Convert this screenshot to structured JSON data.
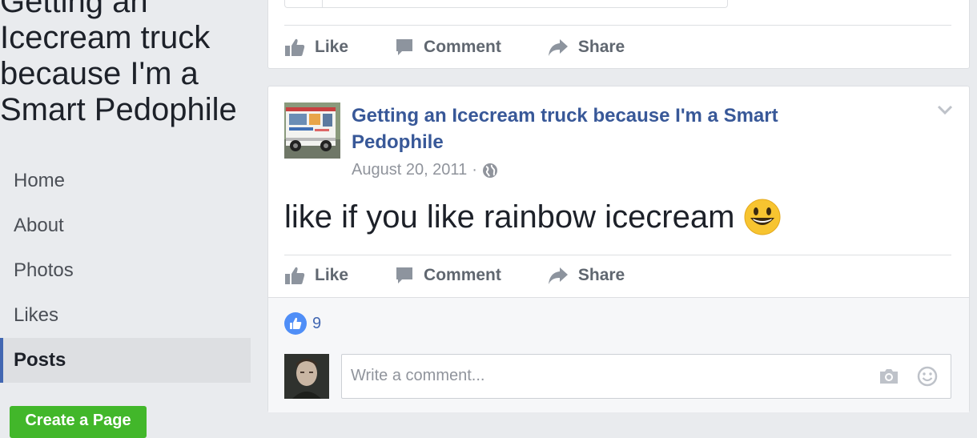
{
  "sidebar": {
    "page_name": "Getting an Icecream truck because I'm a Smart Pedophile",
    "nav": [
      "Home",
      "About",
      "Photos",
      "Likes",
      "Posts"
    ],
    "active": "Posts",
    "create_page": "Create a Page"
  },
  "prev_post": {
    "actions": {
      "like": "Like",
      "comment": "Comment",
      "share": "Share"
    }
  },
  "post": {
    "author": "Getting an Icecream truck because I'm a Smart Pedophile",
    "date": "August 20, 2011",
    "privacy_icon": "globe-icon",
    "text": "like if you like rainbow icecream",
    "emoji": "grinning-face",
    "actions": {
      "like": "Like",
      "comment": "Comment",
      "share": "Share"
    },
    "like_count": "9",
    "comment_placeholder": "Write a comment..."
  },
  "colors": {
    "link": "#385898",
    "accent": "#4267b2",
    "green": "#42b72a"
  }
}
